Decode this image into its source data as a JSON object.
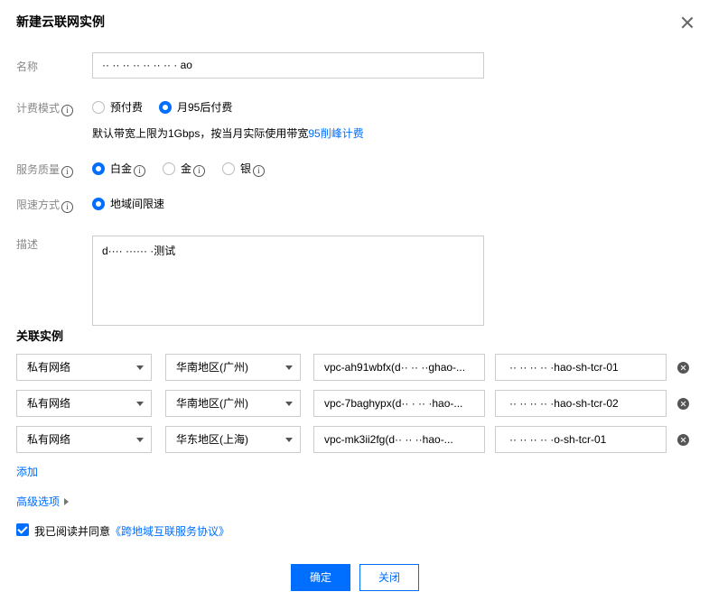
{
  "dialog": {
    "title": "新建云联网实例",
    "close_icon": "close-icon"
  },
  "form": {
    "name": {
      "label": "名称",
      "value": "·· ·· ·· ·· ·· ·· ·· · ao"
    },
    "billing": {
      "label": "计费模式",
      "options": [
        "预付费",
        "月95后付费"
      ],
      "selected": "月95后付费",
      "note_prefix": "默认带宽上限为1Gbps，按当月实际使用带宽",
      "note_link": "95削峰计费"
    },
    "quality": {
      "label": "服务质量",
      "options": [
        "白金",
        "金",
        "银"
      ],
      "selected": "白金"
    },
    "rate_limit": {
      "label": "限速方式",
      "options": [
        "地域间限速"
      ],
      "selected": "地域间限速"
    },
    "description": {
      "label": "描述",
      "value": "d···· ······ ·测试"
    }
  },
  "instances": {
    "title": "关联实例",
    "rows": [
      {
        "type": "私有网络",
        "region": "华南地区(广州)",
        "vpc": "vpc-ah91wbfx(d·· ·· ··ghao-...",
        "name": "·· ·· ·· ·· ·hao-sh-tcr-01"
      },
      {
        "type": "私有网络",
        "region": "华南地区(广州)",
        "vpc": "vpc-7baghypx(d·· · ·· ·hao-...",
        "name": "·· ·· ·· ·· ·hao-sh-tcr-02"
      },
      {
        "type": "私有网络",
        "region": "华东地区(上海)",
        "vpc": "vpc-mk3ii2fg(d·· ·· ··hao-...",
        "name": "·· ·· ·· ·· ·o-sh-tcr-01"
      }
    ],
    "add_label": "添加"
  },
  "advanced_label": "高级选项",
  "agreement": {
    "checked": true,
    "prefix": "我已阅读并同意",
    "link": "《跨地域互联服务协议》"
  },
  "buttons": {
    "confirm": "确定",
    "cancel": "关闭"
  },
  "colors": {
    "accent": "#006eff",
    "border": "#cccccc",
    "label": "#888888"
  }
}
